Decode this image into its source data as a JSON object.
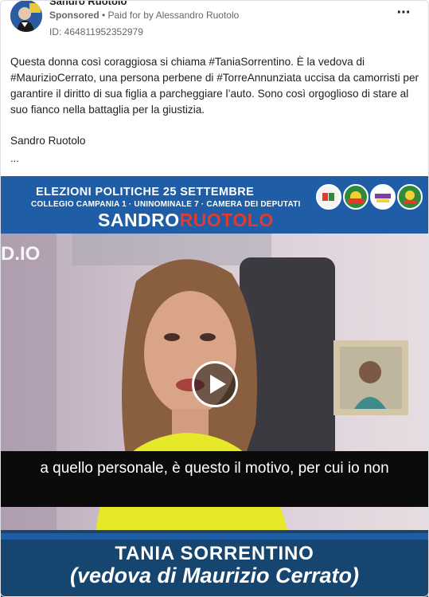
{
  "header": {
    "page_name": "Sandro Ruotolo",
    "sponsored_label": "Sponsored",
    "paid_for": "• Paid for by Alessandro Ruotolo",
    "ad_id": "ID: 464811952352979",
    "more_icon": "more-options-icon"
  },
  "post": {
    "text": "Questa donna così coraggiosa si chiama #TaniaSorrentino. È la vedova di #MaurizioCerrato, una persona perbene di #TorreAnnunziata uccisa da camorristi per garantire il diritto di sua figlia a parcheggiare l’auto. Sono così orgoglioso di stare al suo fianco nella battaglia per la giustizia.",
    "signature": "Sandro Ruotolo",
    "ellipsis": "..."
  },
  "media": {
    "banner_line1": "ELEZIONI POLITICHE 25 SETTEMBRE",
    "banner_line2": "COLLEGIO CAMPANIA 1 · UNINOMINALE 7 · CAMERA DEI DEPUTATI",
    "banner_first_name": "SANDRO",
    "banner_last_name": "RUOTOLO",
    "watermark": "D.IO",
    "subtitle": "a quello personale, è questo il motivo, per cui io non",
    "name_title": "TANIA SORRENTINO",
    "name_sub": "(vedova di Maurizio Cerrato)",
    "play_icon": "play-icon"
  },
  "colors": {
    "banner_blue": "#1f5ea6",
    "accent_red": "#e23a2e",
    "bottom_band": "#16456f"
  }
}
